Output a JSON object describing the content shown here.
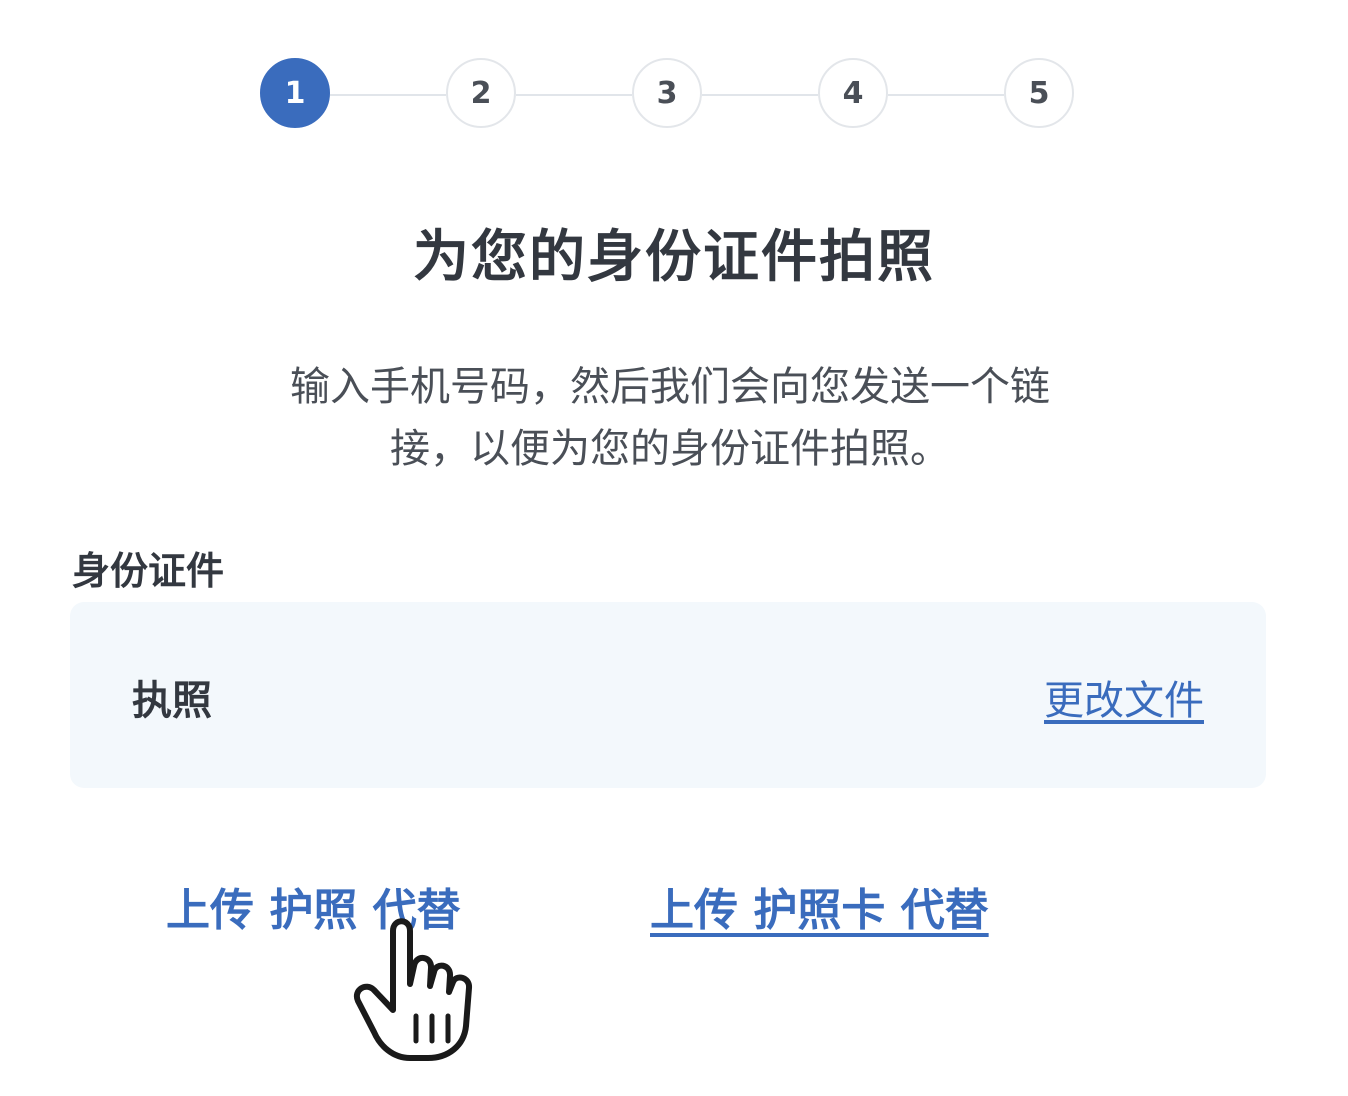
{
  "stepper": {
    "steps": [
      "1",
      "2",
      "3",
      "4",
      "5"
    ],
    "active_step": 1,
    "accent_color": "#3a6cbd"
  },
  "title": "为您的身份证件拍照",
  "description": {
    "line1": "输入手机号码，然后我们会向您发送一个链",
    "line2": "接，以便为您的身份证件拍照。"
  },
  "document": {
    "label": "身份证件",
    "value": "执照",
    "change_link": "更改文件"
  },
  "alternatives": {
    "upload_passport": "上传 护照 代替",
    "upload_passport_card": "上传 护照卡 代替"
  },
  "cursor_icon": "hand-pointer-icon"
}
